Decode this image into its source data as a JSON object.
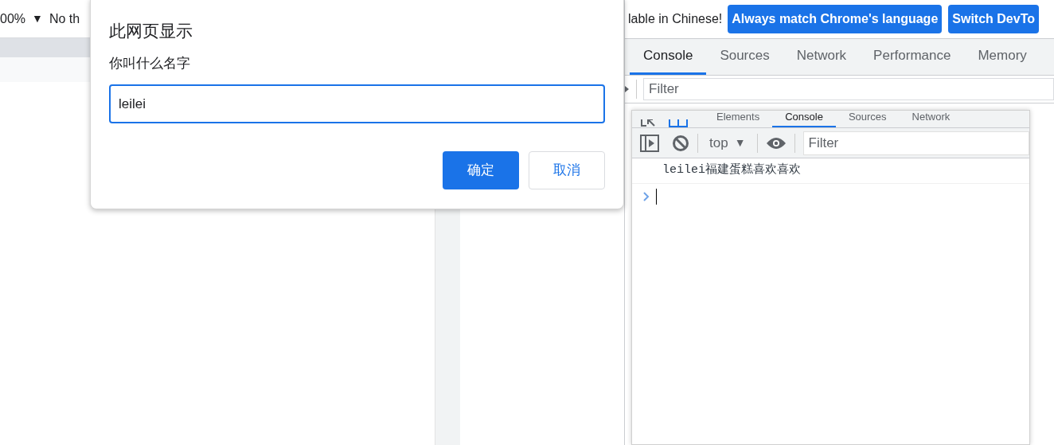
{
  "page": {
    "zoom": "00%",
    "zoom_caret": "▼",
    "throttle": "No th"
  },
  "dialog": {
    "title": "此网页显示",
    "message": "你叫什么名字",
    "input_value": "leilei",
    "buttons": [
      {
        "label": "确定",
        "kind": "primary"
      },
      {
        "label": "取消",
        "kind": "secondary"
      }
    ]
  },
  "devtools": {
    "infobar": {
      "text": "lable in Chinese!",
      "buttons": [
        "Always match Chrome's language",
        "Switch DevTo"
      ]
    },
    "tabs": [
      {
        "label": "Console",
        "selected": true
      },
      {
        "label": "Sources",
        "selected": false
      },
      {
        "label": "Network",
        "selected": false
      },
      {
        "label": "Performance",
        "selected": false
      },
      {
        "label": "Memory",
        "selected": false
      }
    ],
    "filter_placeholder": "Filter"
  },
  "inner_devtools": {
    "tabs": [
      {
        "label": "Elements",
        "selected": false
      },
      {
        "label": "Console",
        "selected": true
      },
      {
        "label": "Sources",
        "selected": false
      },
      {
        "label": "Network",
        "selected": false
      }
    ],
    "context": "top",
    "context_caret": "▼",
    "filter_placeholder": "Filter",
    "log": [
      "leilei福建蛋糕喜欢喜欢"
    ]
  }
}
